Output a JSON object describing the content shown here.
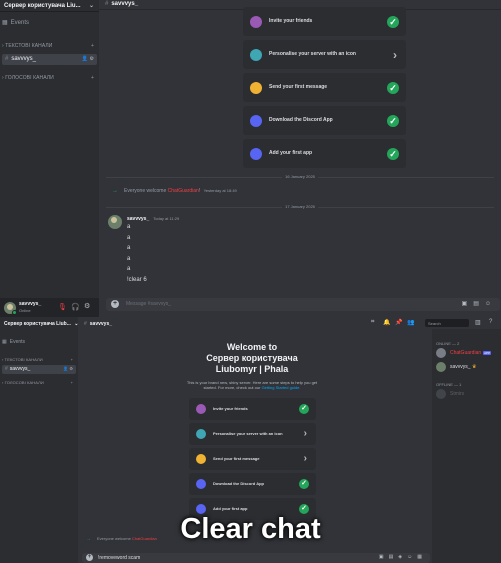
{
  "top": {
    "server_name": "Сервер користувача Liu...",
    "channel_name": "savvvys_",
    "sidebar": {
      "events": "Events",
      "text_category": "ТЕКСТОВІ КАНАЛИ",
      "text_channel": "savvvys_",
      "voice_category": "ГОЛОСОВІ КАНАЛИ"
    },
    "user": {
      "name": "savvvys_",
      "status": "Online"
    },
    "tasks": [
      {
        "label": "Invite your friends",
        "done": true,
        "icon_color": "#9b59b6"
      },
      {
        "label": "Personalise your server with an icon",
        "done": false,
        "icon_color": "#3fa6b4"
      },
      {
        "label": "Send your first message",
        "done": true,
        "icon_color": "#f0b232"
      },
      {
        "label": "Download the Discord App",
        "done": true,
        "icon_color": "#5865f2"
      },
      {
        "label": "Add your first app",
        "done": true,
        "icon_color": "#5865f2"
      }
    ],
    "system_message": {
      "prefix": "Everyone welcome",
      "bot": "ChatGuardian",
      "suffix": "!",
      "timestamp": "Yesterday at 18:49"
    },
    "date_1": "16 January 2025",
    "date_2": "17 January 2025",
    "message": {
      "author": "savvvys_",
      "timestamp": "Today at 11:29",
      "lines": [
        "a",
        "a",
        "a",
        "a",
        "a",
        "!clear 6"
      ]
    },
    "composer_placeholder": "Message #savvvys_"
  },
  "bottom": {
    "server_name": "Сервер користувача Liub...",
    "channel_name": "savvvys_",
    "search_placeholder": "Search",
    "sidebar": {
      "events": "Events",
      "text_category": "ТЕКСТОВІ КАНАЛИ",
      "text_channel": "savvvys_",
      "voice_category": "ГОЛОСОВІ КАНАЛИ"
    },
    "welcome_title": [
      "Welcome to",
      "Сервер користувача",
      "Liubomyr | Phala"
    ],
    "welcome_sub": "This is your brand new, shiny server. Here are some steps to help you get started. For more, check out our",
    "welcome_link": "Getting Started guide.",
    "tasks": [
      {
        "label": "Invite your friends",
        "done": true,
        "icon_color": "#9b59b6"
      },
      {
        "label": "Personalise your server with an icon",
        "done": false,
        "icon_color": "#3fa6b4"
      },
      {
        "label": "Send your first message",
        "done": false,
        "icon_color": "#f0b232"
      },
      {
        "label": "Download the Discord App",
        "done": true,
        "icon_color": "#5865f2"
      },
      {
        "label": "Add your first app",
        "done": true,
        "icon_color": "#5865f2"
      }
    ],
    "system_message": {
      "prefix": "Everyone welcome",
      "bot": "ChatGuardian"
    },
    "members": {
      "online_header": "ONLINE — 2",
      "online": [
        {
          "name": "ChatGuardian",
          "tag": "APP",
          "color": "#f23f43"
        },
        {
          "name": "savvvys_",
          "tag": "",
          "color": "#dbdee1"
        }
      ],
      "offline_header": "OFFLINE — 1",
      "offline": [
        {
          "name": "Stmirs",
          "color": "#6d6f78"
        }
      ]
    },
    "composer_text": "!removeword scam"
  },
  "caption": "Clear chat",
  "colors": {
    "accent_green": "#23a55a",
    "bot_red": "#f23f43",
    "link_blue": "#00a8fc",
    "background": "#313338",
    "sidebar": "#2b2d31"
  }
}
